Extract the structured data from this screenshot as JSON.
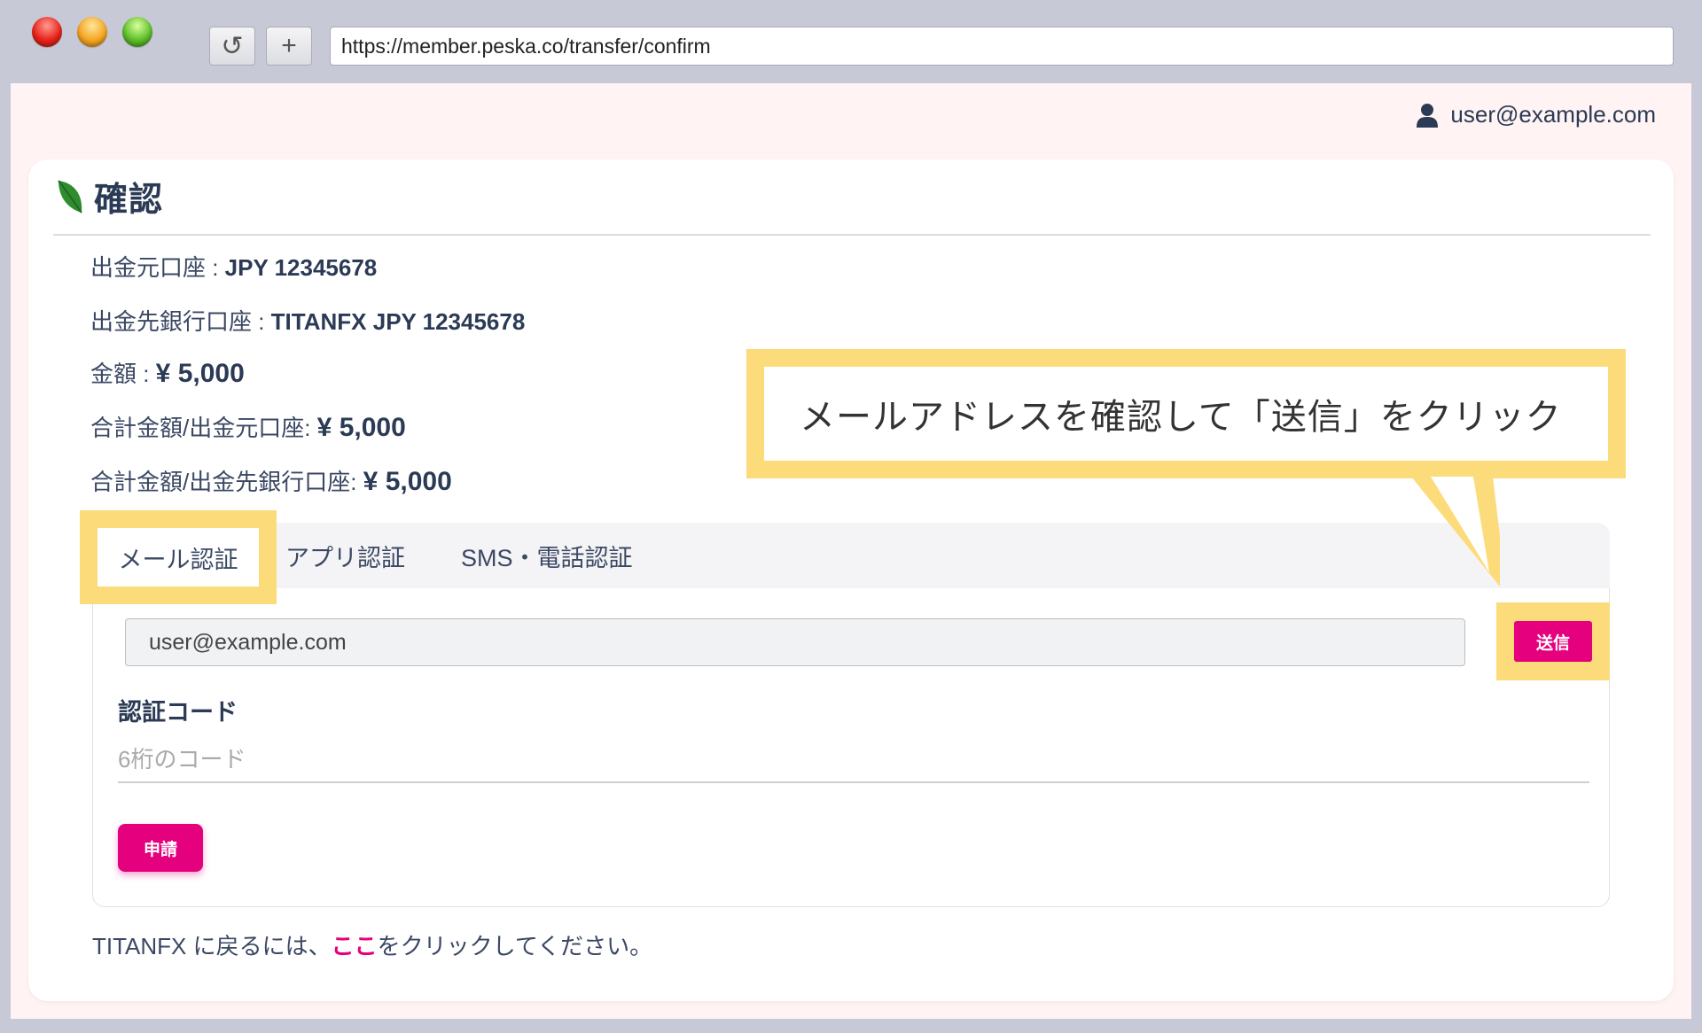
{
  "browser": {
    "url": "https://member.peska.co/transfer/confirm",
    "reload_icon": "↺",
    "newtab_icon": "+"
  },
  "header": {
    "user_email": "user@example.com"
  },
  "card": {
    "title": "確認",
    "lines": [
      {
        "label": "出金元口座 : ",
        "value": "JPY 12345678"
      },
      {
        "label": "出金先銀行口座 : ",
        "value": "TITANFX JPY 12345678"
      },
      {
        "label": "金額 : ",
        "value": "¥ 5,000"
      },
      {
        "label": "合計金額/出金元口座: ",
        "value": "¥ 5,000"
      },
      {
        "label": "合計金額/出金先銀行口座: ",
        "value": "¥ 5,000"
      }
    ]
  },
  "tabs": [
    {
      "label": "メール認証"
    },
    {
      "label": "アプリ認証"
    },
    {
      "label": "SMS・電話認証"
    }
  ],
  "panel": {
    "email_value": "user@example.com",
    "send_label": "送信",
    "code_label": "認証コード",
    "code_placeholder": "6桁のコード",
    "apply_label": "申請"
  },
  "footer": {
    "prefix": "TITANFX に戻るには、",
    "link": "ここ",
    "suffix": "をクリックしてください。"
  },
  "callout": {
    "text": "メールアドレスを確認して「送信」をクリック"
  },
  "colors": {
    "accent": "#e5007d",
    "highlight": "#fcdc7a",
    "text_dark": "#2b3a55"
  }
}
